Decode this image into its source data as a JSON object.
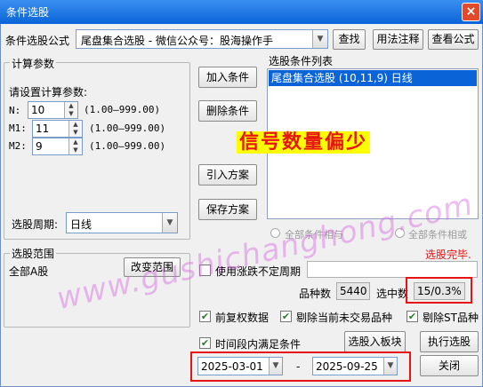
{
  "window": {
    "title": "条件选股",
    "close_glyph": "×"
  },
  "formula": {
    "label": "条件选股公式",
    "value": "尾盘集合选股  -  微信公众号：股海操作手",
    "find_label": "查找",
    "usage_label": "用法注释",
    "view_label": "查看公式"
  },
  "params": {
    "group_label": "计算参数",
    "prompt": "请设置计算参数:",
    "items": [
      {
        "name": "N:",
        "value": "10",
        "range": "(1.00—999.00)"
      },
      {
        "name": "M1:",
        "value": "11",
        "range": "(1.00—999.00)"
      },
      {
        "name": "M2:",
        "value": "9",
        "range": "(1.00—999.00)"
      }
    ],
    "period_label": "选股周期:",
    "period_value": "日线"
  },
  "actions": {
    "add": "加入条件",
    "delete": "删除条件",
    "import": "引入方案",
    "save": "保存方案"
  },
  "condition_list": {
    "label": "选股条件列表",
    "items": [
      "尾盘集合选股 (10,11,9) 日线"
    ]
  },
  "overlay": {
    "text": "信号数量偏少",
    "color": "#e81414",
    "highlight": "#ffff00"
  },
  "logic": {
    "and_label": "全部条件相与",
    "or_label": "全部条件相或"
  },
  "status": {
    "done": "选股完毕.",
    "color": "#e81414"
  },
  "scope": {
    "group_label": "选股范围",
    "value": "全部A股",
    "change_label": "改变范围"
  },
  "options": {
    "irregular_period": "使用涨跌不定周期",
    "count_label": "品种数",
    "count_value": "5440",
    "selected_label": "选中数",
    "selected_value": "15/0.3%",
    "forward_adjust": "前复权数据",
    "exclude_untraded": "剔除当前未交易品种",
    "exclude_st": "剔除ST品种",
    "time_range": "时间段内满足条件",
    "to_board": "选股入板块",
    "execute": "执行选股",
    "date_from": "2025-03-01",
    "date_sep": "-",
    "date_to": "2025-09-25",
    "close": "关闭",
    "check_glyph": "✔"
  },
  "watermark": "www.gushichanghong.com"
}
